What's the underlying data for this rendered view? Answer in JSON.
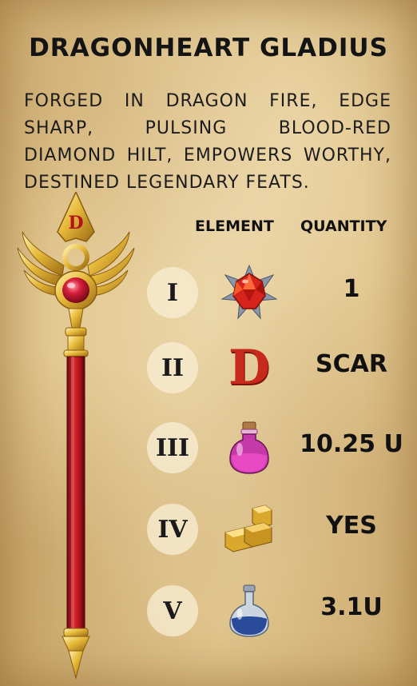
{
  "card": {
    "title": "DRAGONHEART GLADIUS",
    "description": "FORGED IN DRAGON FIRE, EDGE SHARP, PULSING BLOOD-RED DIAMOND HILT, EMPOWERS WORTHY, DESTINED LEGENDARY FEATS."
  },
  "table": {
    "headers": {
      "element": "ELEMENT",
      "quantity": "QUANTITY"
    },
    "rows": [
      {
        "numeral": "I",
        "icon": "red-gem-icon",
        "quantity": "1"
      },
      {
        "numeral": "II",
        "icon": "letter-d-icon",
        "letter": "D",
        "quantity": "SCAR"
      },
      {
        "numeral": "III",
        "icon": "pink-potion-icon",
        "quantity": "10.25 U"
      },
      {
        "numeral": "IV",
        "icon": "gold-bars-icon",
        "quantity": "YES"
      },
      {
        "numeral": "V",
        "icon": "blue-flask-icon",
        "quantity": "3.1U"
      }
    ]
  },
  "staff": {
    "letter": "D"
  },
  "colors": {
    "parchment": "#e2c891",
    "staff_red": "#b3121c",
    "gold": "#e6b93a",
    "gem_red": "#d6231b"
  }
}
